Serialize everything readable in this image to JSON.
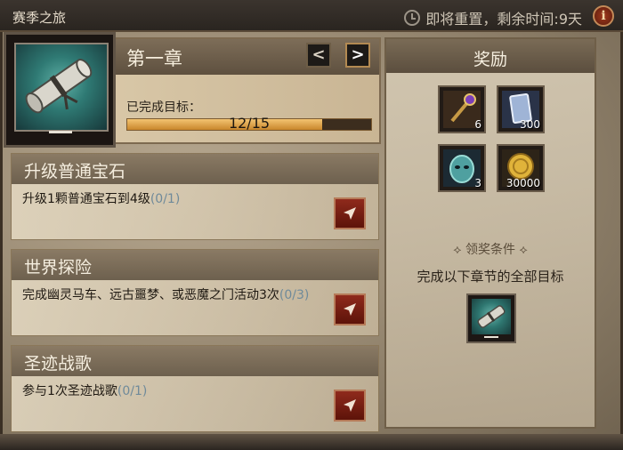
{
  "window": {
    "title": "赛季之旅"
  },
  "reset": {
    "text": "即将重置，剩余时间:9天"
  },
  "chapter": {
    "title": "第一章",
    "prev_label": "<",
    "next_label": ">",
    "completed_label": "已完成目标：",
    "progress": {
      "done": 12,
      "total": 15,
      "text": "12/15",
      "fraction": 0.8
    },
    "item_badge": "—"
  },
  "tasks": [
    {
      "title": "升级普通宝石",
      "desc": "升级1颗普通宝石到4级",
      "count": "(0/1)"
    },
    {
      "title": "世界探险",
      "desc": "完成幽灵马车、远古噩梦、或恶魔之门活动3次",
      "count": "(0/3)"
    },
    {
      "title": "圣迹战歌",
      "desc": "参与1次圣迹战歌",
      "count": "(0/1)"
    }
  ],
  "rewards": {
    "title": "奖励",
    "items": [
      {
        "icon": "scepter-icon",
        "count": "6"
      },
      {
        "icon": "card-icon",
        "count": "300"
      },
      {
        "icon": "demon-mask-icon",
        "count": "3"
      },
      {
        "icon": "gold-coin-icon",
        "count": "30000"
      }
    ],
    "condition_label": "领奖条件",
    "condition_text": "完成以下章节的全部目标",
    "chapter_badge": "—"
  },
  "colors": {
    "accent_orange": "#e9a24a",
    "button_red": "#8f2a1c",
    "count_blue": "#6f8a9a"
  }
}
